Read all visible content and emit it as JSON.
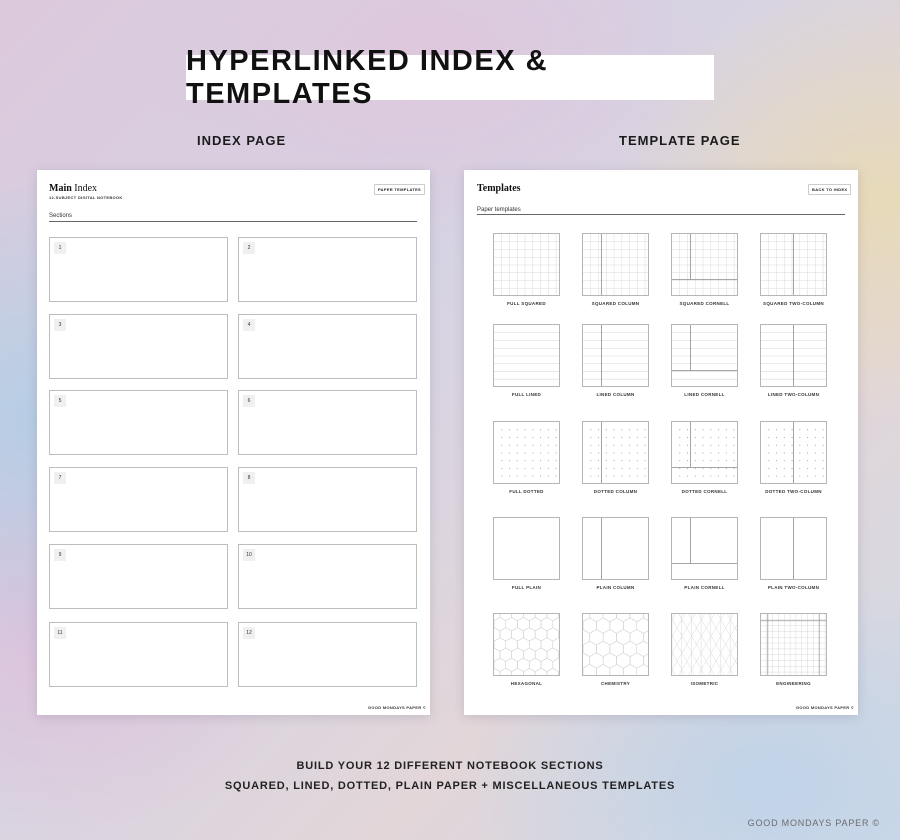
{
  "headline": "HYPERLINKED INDEX & TEMPLATES",
  "labels": {
    "left": "INDEX PAGE",
    "right": "TEMPLATE PAGE"
  },
  "index_page": {
    "title_bold": "Main",
    "title_rest": " Index",
    "subtitle": "12-SUBJECT DIGITAL NOTEBOOK",
    "button": "PAPER TEMPLATES",
    "section_label": "Sections",
    "sections": [
      "1",
      "2",
      "3",
      "4",
      "5",
      "6",
      "7",
      "8",
      "9",
      "10",
      "11",
      "12"
    ],
    "footer": "GOOD MONDAYS PAPER ©"
  },
  "template_page": {
    "title": "Templates",
    "button": "BACK TO INDEX",
    "section_label": "Paper templates",
    "templates": [
      {
        "label": "FULL SQUARED",
        "kind": "grid",
        "layout": "full"
      },
      {
        "label": "SQUARED COLUMN",
        "kind": "grid",
        "layout": "column"
      },
      {
        "label": "SQUARED CORNELL",
        "kind": "grid",
        "layout": "cornell"
      },
      {
        "label": "SQUARED TWO-COLUMN",
        "kind": "grid",
        "layout": "two"
      },
      {
        "label": "FULL LINED",
        "kind": "lined",
        "layout": "full"
      },
      {
        "label": "LINED COLUMN",
        "kind": "lined",
        "layout": "column"
      },
      {
        "label": "LINED CORNELL",
        "kind": "lined",
        "layout": "cornell"
      },
      {
        "label": "LINED TWO-COLUMN",
        "kind": "lined",
        "layout": "two"
      },
      {
        "label": "FULL DOTTED",
        "kind": "dotted",
        "layout": "full"
      },
      {
        "label": "DOTTED COLUMN",
        "kind": "dotted",
        "layout": "column"
      },
      {
        "label": "DOTTED CORNELL",
        "kind": "dotted",
        "layout": "cornell"
      },
      {
        "label": "DOTTED TWO-COLUMN",
        "kind": "dotted",
        "layout": "two"
      },
      {
        "label": "FULL PLAIN",
        "kind": "plain",
        "layout": "full"
      },
      {
        "label": "PLAIN COLUMN",
        "kind": "plain",
        "layout": "column"
      },
      {
        "label": "PLAIN CORNELL",
        "kind": "plain",
        "layout": "cornell"
      },
      {
        "label": "PLAIN TWO-COLUMN",
        "kind": "plain",
        "layout": "two"
      },
      {
        "label": "HEXAGONAL",
        "kind": "hex",
        "layout": "full"
      },
      {
        "label": "CHEMISTRY",
        "kind": "chem",
        "layout": "full"
      },
      {
        "label": "ISOMETRIC",
        "kind": "iso",
        "layout": "full"
      },
      {
        "label": "ENGINEERING",
        "kind": "eng",
        "layout": "full"
      }
    ],
    "footer": "GOOD MONDAYS PAPER ©"
  },
  "captions": [
    "BUILD YOUR 12 DIFFERENT NOTEBOOK SECTIONS",
    "SQUARED, LINED, DOTTED, PLAIN PAPER + MISCELLANEOUS TEMPLATES"
  ],
  "brand": "GOOD MONDAYS PAPER ©"
}
